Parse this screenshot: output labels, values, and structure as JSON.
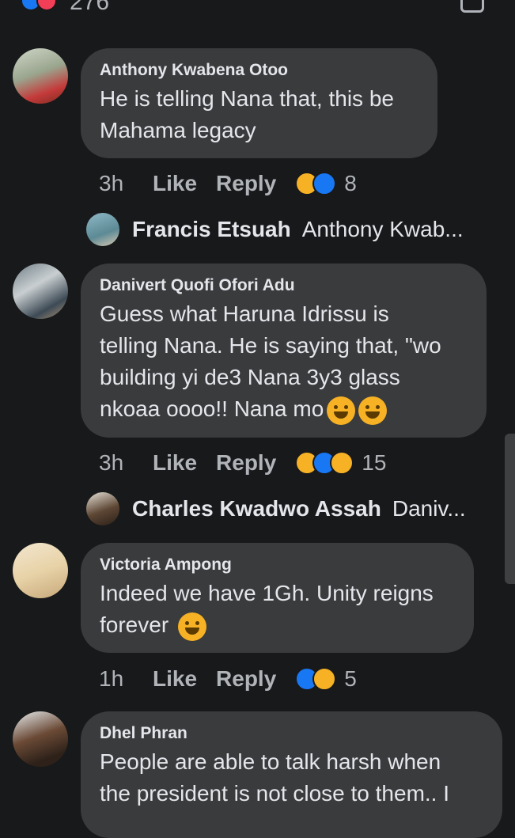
{
  "top": {
    "count": "276"
  },
  "comments": [
    {
      "name": "Anthony Kwabena Otoo",
      "text": "He is telling Nana that, this be\nMahama legacy",
      "time": "3h",
      "like_label": "Like",
      "reply_label": "Reply",
      "reactions": [
        "haha",
        "like"
      ],
      "reaction_count": "8",
      "reply": {
        "name": "Francis Etsuah",
        "preview": "Anthony Kwab..."
      }
    },
    {
      "name": "Danivert Quofi Ofori Adu",
      "text": "Guess what Haruna Idrissu is\ntelling Nana. He is saying that, \"wo\nbuilding yi de3 Nana 3y3 glass\nnkoaa oooo!! Nana mo",
      "time": "3h",
      "like_label": "Like",
      "reply_label": "Reply",
      "reactions": [
        "haha",
        "like",
        "wow"
      ],
      "reaction_count": "15",
      "reply": {
        "name": "Charles Kwadwo Assah",
        "preview": "Daniv..."
      }
    },
    {
      "name": "Victoria Ampong",
      "text": "Indeed we have 1Gh. Unity reigns\nforever",
      "time": "1h",
      "like_label": "Like",
      "reply_label": "Reply",
      "reactions": [
        "like",
        "kiss"
      ],
      "reaction_count": "5"
    },
    {
      "name": "Dhel Phran",
      "text": "People are able to talk harsh when\nthe president is not close to them.. I"
    }
  ],
  "colors": {
    "background": "#18191a",
    "bubble": "#3a3b3c",
    "text": "#e4e6eb",
    "muted": "#b0b3b8",
    "like_blue": "#1877f2"
  }
}
